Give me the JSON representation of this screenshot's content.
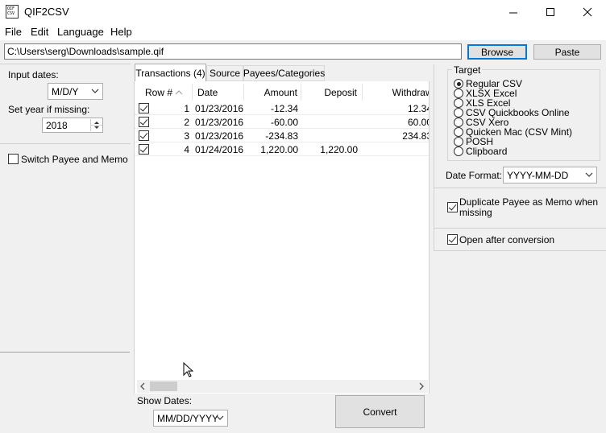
{
  "app": {
    "icon_text": "QIF\nCSV",
    "title": "QIF2CSV"
  },
  "window_controls": {
    "minimize": "—",
    "maximize": "☐",
    "close": "✕"
  },
  "menu": [
    "File",
    "Edit",
    "Language",
    "Help"
  ],
  "path": {
    "value": "C:\\Users\\serg\\Downloads\\sample.qif"
  },
  "buttons": {
    "browse": "Browse",
    "paste": "Paste",
    "convert": "Convert"
  },
  "left": {
    "input_dates_label": "Input dates:",
    "input_dates_value": "M/D/Y",
    "set_year_label": "Set year if missing:",
    "year_value": "2018",
    "switch_payee_label": "Switch Payee and Memo",
    "switch_payee_checked": false
  },
  "tabs": [
    "Transactions (4)",
    "Source",
    "Payees/Categories"
  ],
  "grid": {
    "columns": [
      "Row #",
      "Date",
      "Amount",
      "Deposit",
      "Withdrawal"
    ],
    "rows": [
      {
        "checked": true,
        "row": "1",
        "date": "01/23/2016",
        "amount": "-12.34",
        "deposit": "",
        "withdrawal": "12.34"
      },
      {
        "checked": true,
        "row": "2",
        "date": "01/23/2016",
        "amount": "-60.00",
        "deposit": "",
        "withdrawal": "60.00"
      },
      {
        "checked": true,
        "row": "3",
        "date": "01/23/2016",
        "amount": "-234.83",
        "deposit": "",
        "withdrawal": "234.83"
      },
      {
        "checked": true,
        "row": "4",
        "date": "01/24/2016",
        "amount": "1,220.00",
        "deposit": "1,220.00",
        "withdrawal": ""
      }
    ]
  },
  "show_dates": {
    "label": "Show Dates:",
    "value": "MM/DD/YYYY"
  },
  "target": {
    "label": "Target",
    "options": [
      "Regular CSV",
      "XLSX Excel",
      "XLS Excel",
      "CSV Quickbooks Online",
      "CSV Xero",
      "Quicken Mac (CSV Mint)",
      "POSH",
      "Clipboard"
    ],
    "selected": "Regular CSV"
  },
  "date_format": {
    "label": "Date Format:",
    "value": "YYYY-MM-DD"
  },
  "options": {
    "duplicate_payee": "Duplicate Payee as Memo when missing",
    "duplicate_payee_checked": true,
    "open_after": "Open after conversion",
    "open_after_checked": true
  },
  "colors": {
    "accent": "#0078d7",
    "window_bg": "#f0f0f0"
  }
}
